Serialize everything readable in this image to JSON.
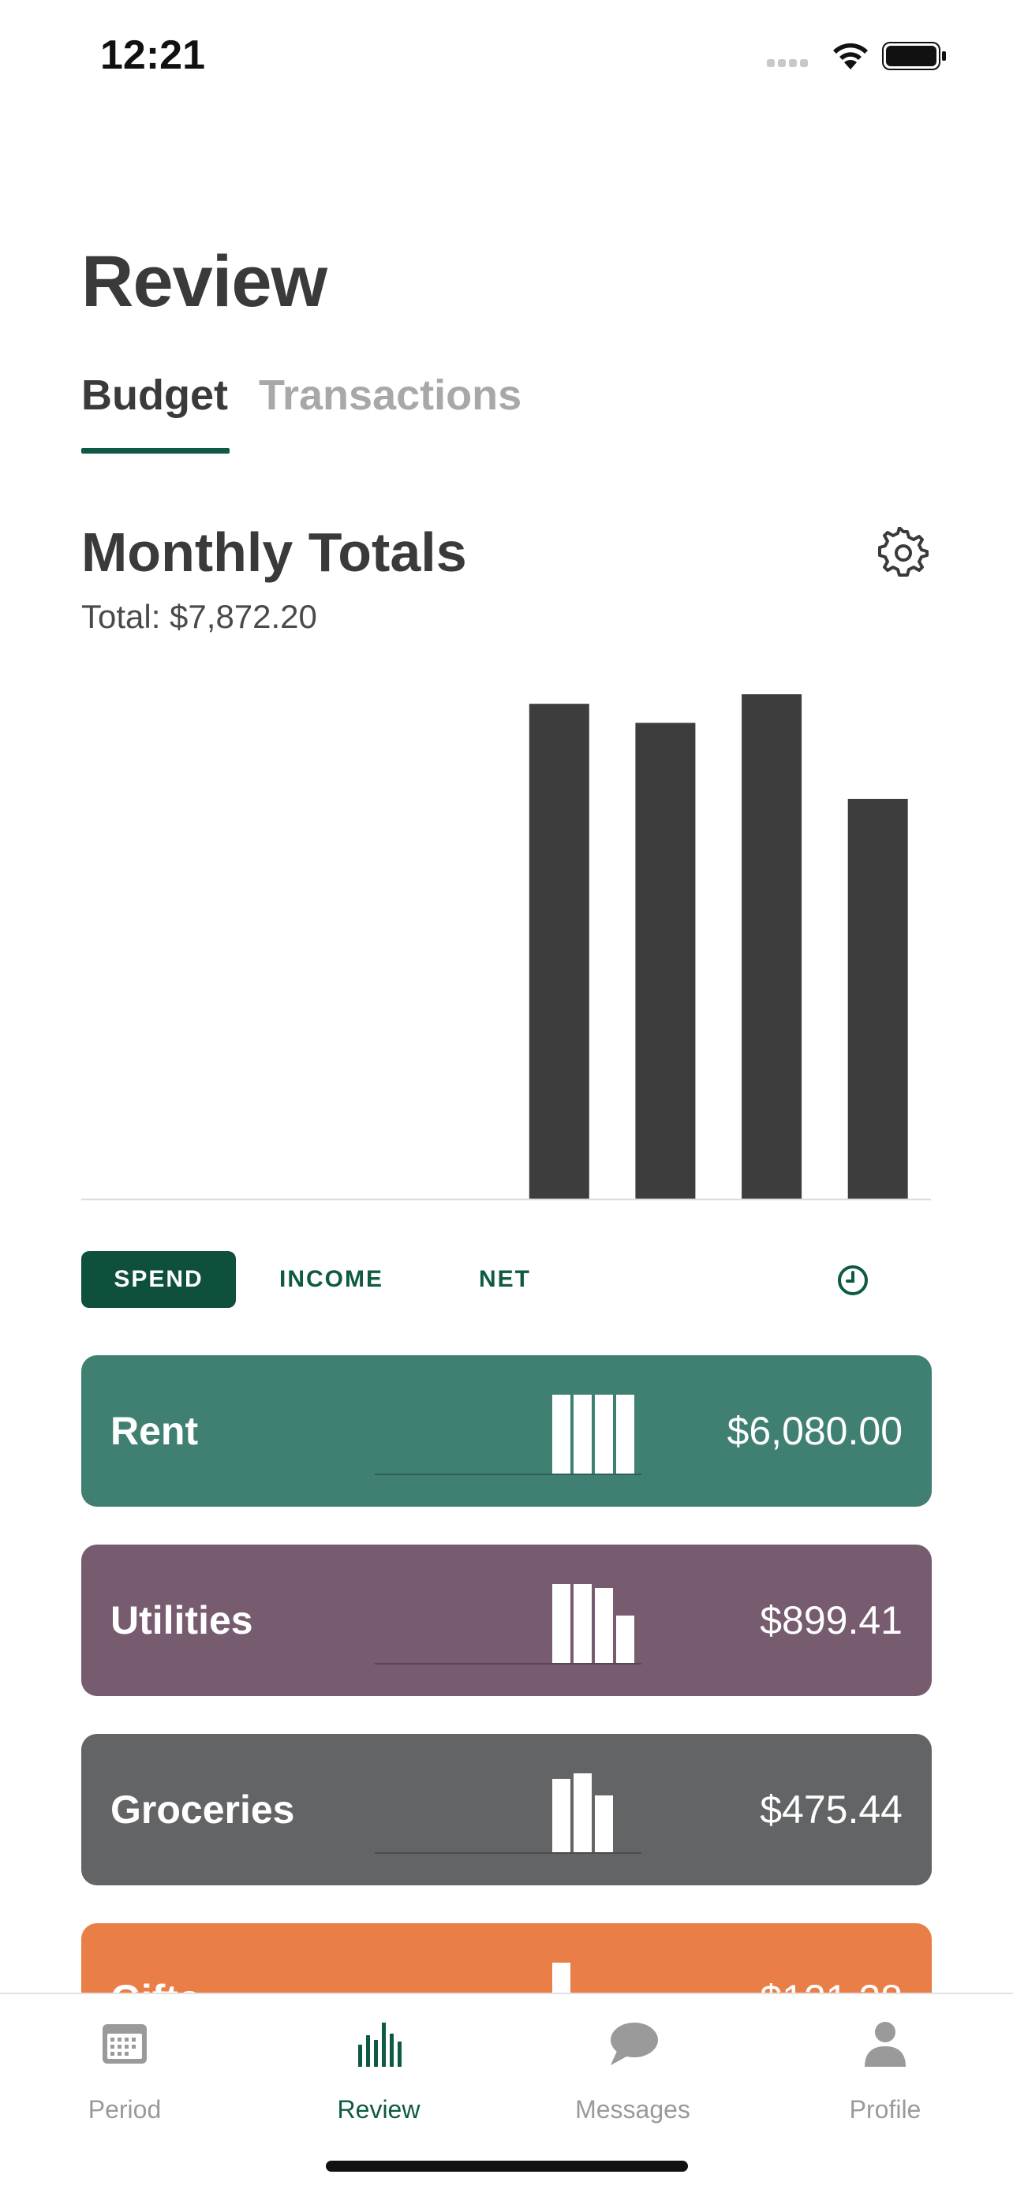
{
  "status_bar": {
    "time": "12:21"
  },
  "page": {
    "title": "Review"
  },
  "tabs": [
    {
      "label": "Budget",
      "active": true
    },
    {
      "label": "Transactions",
      "active": false
    }
  ],
  "section": {
    "title": "Monthly Totals",
    "total": "Total: $7,872.20"
  },
  "chart_data": {
    "type": "bar",
    "categories": [
      "",
      "",
      "",
      "",
      "",
      "",
      "",
      ""
    ],
    "values": [
      0,
      0,
      0,
      0,
      7800,
      7500,
      7950,
      6300
    ],
    "ylim": [
      0,
      8200
    ],
    "grid": false,
    "color": "#3d3d3d"
  },
  "filters": [
    {
      "label": "SPEND",
      "active": true
    },
    {
      "label": "INCOME",
      "active": false
    },
    {
      "label": "NET",
      "active": false
    }
  ],
  "categories": [
    {
      "name": "Rent",
      "amount": "$6,080.00",
      "color": "#3f8072",
      "spark": [
        1,
        1,
        1,
        1
      ]
    },
    {
      "name": "Utilities",
      "amount": "$899.41",
      "color": "#775b6e",
      "spark": [
        1,
        1,
        0.95,
        0.6
      ]
    },
    {
      "name": "Groceries",
      "amount": "$475.44",
      "color": "#636466",
      "spark": [
        0.93,
        1,
        0.72
      ]
    },
    {
      "name": "Gifts",
      "amount": "$121.28",
      "color": "#ea7e47",
      "spark": [
        1
      ]
    }
  ],
  "nav": [
    {
      "label": "Period",
      "icon": "calendar-icon",
      "active": false
    },
    {
      "label": "Review",
      "icon": "bar-chart-icon",
      "active": true
    },
    {
      "label": "Messages",
      "icon": "chat-bubble-icon",
      "active": false
    },
    {
      "label": "Profile",
      "icon": "person-icon",
      "active": false
    }
  ],
  "colors": {
    "accent": "#0e5a44",
    "text": "#3a3a3a",
    "muted": "#a8a8a8"
  }
}
